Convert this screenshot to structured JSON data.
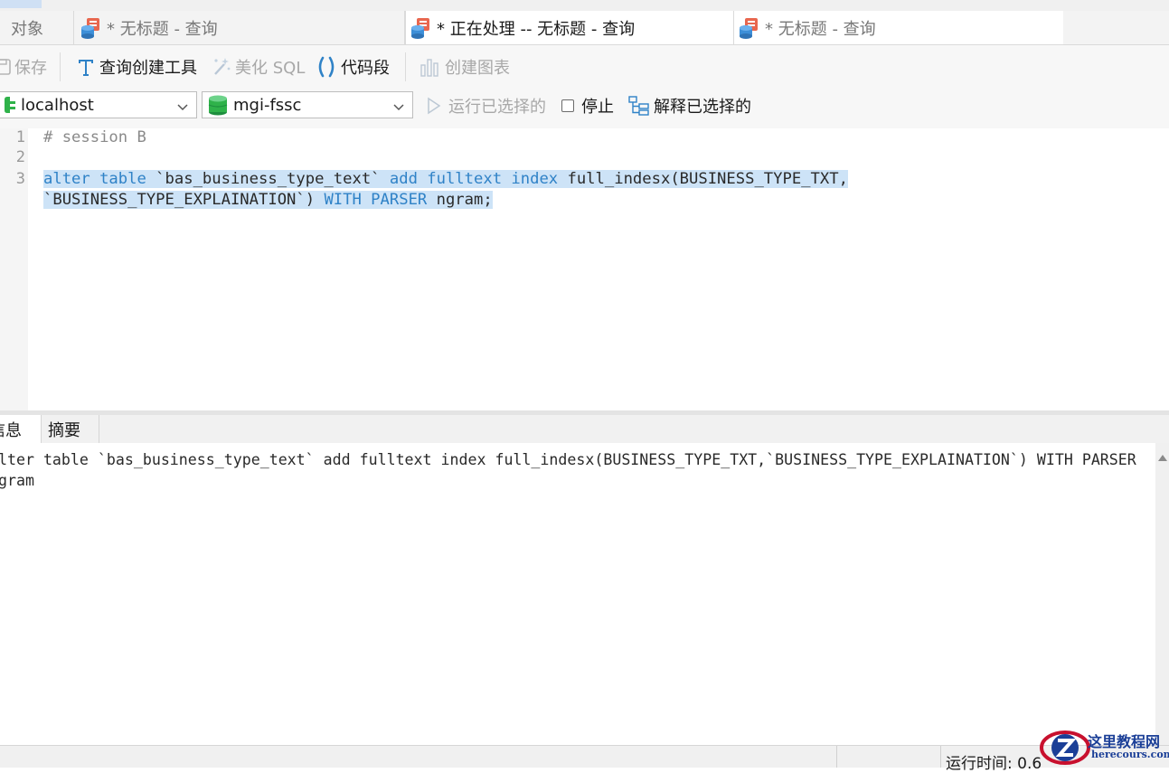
{
  "top_menu": {
    "fragment_1": "",
    "fragment_2": ""
  },
  "tabs": [
    {
      "label": "对象"
    },
    {
      "label": "* 无标题 - 查询"
    },
    {
      "label": "* 正在处理 -- 无标题 - 查询"
    },
    {
      "label": "* 无标题 - 查询"
    }
  ],
  "toolbar": {
    "save": "保存",
    "query_builder": "查询创建工具",
    "beautify_sql": "美化 SQL",
    "code_snippet": "代码段",
    "create_chart": "创建图表"
  },
  "connection": {
    "host": "localhost",
    "database": "mgi-fssc",
    "run_selected": "运行已选择的",
    "stop": "停止",
    "explain_selected": "解释已选择的"
  },
  "editor": {
    "line_numbers": [
      "1",
      "2",
      "3"
    ],
    "line1_comment": "# session B",
    "line3": {
      "kw1": "alter table",
      "t1": " `bas_business_type_text` ",
      "kw2": "add fulltext index",
      "t2": " full_indesx(BUSINESS_TYPE_TXT,",
      "t3": "`BUSINESS_TYPE_EXPLAINATION`) ",
      "kw3": "WITH PARSER",
      "t4": " ngram;"
    }
  },
  "result_tabs": {
    "message": "信息",
    "summary": "摘要"
  },
  "message_text": "alter table `bas_business_type_text` add fulltext index full_indesx(BUSINESS_TYPE_TXT,`BUSINESS_TYPE_EXPLAINATION`) WITH PARSER ngram",
  "status": {
    "runtime": "运行时间: 0.6"
  },
  "watermark": {
    "cn": "这里教程网",
    "en": "herecours.com"
  },
  "colors": {
    "keyword": "#2f82c7",
    "selection": "#cde3f7",
    "watermark": "#1b3f97"
  }
}
